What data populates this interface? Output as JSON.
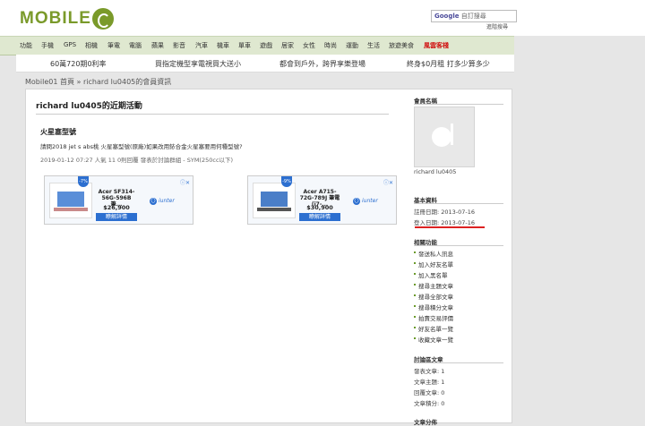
{
  "logo": {
    "text": "MOBILE"
  },
  "search": {
    "brand": "Google",
    "placeholder": "自訂搜尋",
    "advanced_link": "進階搜尋"
  },
  "nav": {
    "items": [
      "功能",
      "手機",
      "GPS",
      "相機",
      "筆電",
      "電腦",
      "蘋果",
      "影音",
      "汽車",
      "機車",
      "單車",
      "遊戲",
      "居家",
      "女性",
      "時尚",
      "運動",
      "生活",
      "旅遊美食",
      "風雲客棧"
    ]
  },
  "promo": {
    "items": [
      "60萬720期0利率",
      "買指定機型享電視買大送小",
      "都會到戶外，跨界享樂登場",
      "終身$0月租 打多少算多少"
    ]
  },
  "breadcrumb": {
    "home": "Mobile01 首頁",
    "separator": "»",
    "current": "richard lu0405的會員資訊"
  },
  "activity": {
    "heading": "richard lu0405的近期活動",
    "post_title": "火星塞型號",
    "post_body": "請問2018 jet s abs桃 火星塞型號(原廠)如果改用銥合金火星塞要用何種型號?",
    "post_meta": "2019-01-12 07:27  人氣 11  0則回覆  發表於討論群組 - SYM(250cc以下)"
  },
  "ads": [
    {
      "discount": "-7%",
      "name": "Acer SF314-56G-596B 筆...",
      "price": "$26,900",
      "button": "瞭解詳情",
      "brand": "iunter"
    },
    {
      "discount": "-9%",
      "name": "Acer A715-72G-789J 筆電 (i7-...",
      "price": "$30,900",
      "button": "瞭解詳情",
      "brand": "iunter"
    }
  ],
  "ad_info": "ⓘ✕",
  "sidebar": {
    "member_name_heading": "會員名稱",
    "member_name": "richard lu0405",
    "basic_heading": "基本資料",
    "register_date": "註冊日期: 2013-07-16",
    "login_date": "登入日期: 2013-07-16",
    "functions_heading": "相關功能",
    "functions": [
      "發送私人訊息",
      "加入好友名單",
      "加入黑名單",
      "搜尋主題文章",
      "搜尋全部文章",
      "搜尋積分文章",
      "拍賣交易評價",
      "好友名單一覽",
      "收藏文章一覽"
    ],
    "stats_heading": "討論區文章",
    "stats": [
      "發表文章: 1",
      "文章主題: 1",
      "回覆文章: 0",
      "文章積分: 0"
    ],
    "category_heading": "文章分佈"
  },
  "colors": {
    "brand_green": "#7a9a2a",
    "hot_red": "#d01010",
    "ad_blue": "#2c6fd0",
    "underline_red": "#dd2222"
  },
  "icons": {
    "logo_mark": "mobile01-logo-icon",
    "avatar": "default-avatar-icon",
    "ad_choices": "ad-choices-icon"
  }
}
